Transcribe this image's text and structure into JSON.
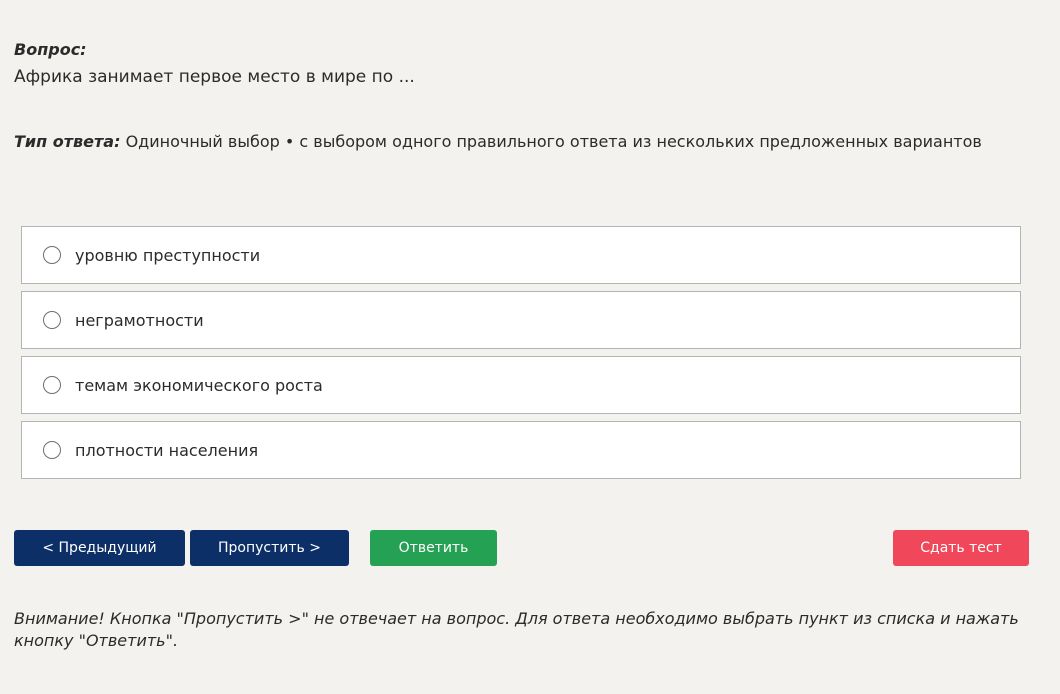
{
  "question": {
    "label": "Вопрос:",
    "text": "Африка занимает первое место в мире по ..."
  },
  "answer_type": {
    "label": "Тип ответа:",
    "value": "Одиночный выбор • с выбором одного правильного ответа из нескольких предложенных вариантов"
  },
  "options": [
    {
      "label": "уровню преступности",
      "selected": false
    },
    {
      "label": "неграмотности",
      "selected": false
    },
    {
      "label": "темам экономического роста",
      "selected": false
    },
    {
      "label": "плотности населения",
      "selected": false
    }
  ],
  "buttons": {
    "prev": "< Предыдущий",
    "skip": "Пропустить >",
    "answer": "Ответить",
    "submit": "Сдать тест"
  },
  "colors": {
    "background": "#f3f2ef",
    "nav_button": "#0b2f66",
    "answer_button": "#24a152",
    "submit_button": "#f1475a"
  },
  "notice": "Внимание! Кнопка \"Пропустить >\" не отвечает на вопрос. Для ответа необходимо выбрать пункт из списка и нажать кнопку \"Ответить\"."
}
